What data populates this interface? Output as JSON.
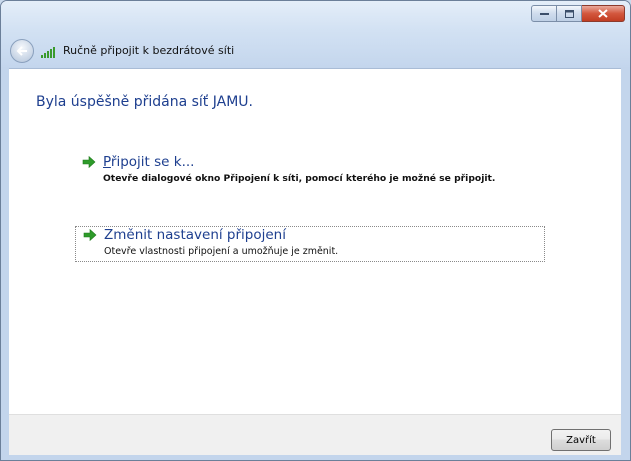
{
  "window": {
    "title": "Ručně připojit k bezdrátové síti",
    "caption_buttons": [
      "minimize-icon",
      "maximize-icon",
      "close-icon"
    ]
  },
  "content": {
    "heading": "Byla úspěšně přidána síť JAMU.",
    "options": [
      {
        "title_underlined_char": "P",
        "title_rest": "řipojit se k...",
        "description": "Otevře dialogové okno Připojení k síti, pomocí kterého je možné se připojit.",
        "icon": "green-arrow-icon"
      },
      {
        "title": "Změnit nastavení připojení",
        "description": "Otevře vlastnosti připojení a umožňuje je změnit.",
        "icon": "green-arrow-icon",
        "focused": true
      }
    ]
  },
  "footer": {
    "close_label": "Zavřít"
  },
  "colors": {
    "heading": "#1e3f8f",
    "arrow": "#2e9b2a",
    "close_button": "#c13d22"
  }
}
